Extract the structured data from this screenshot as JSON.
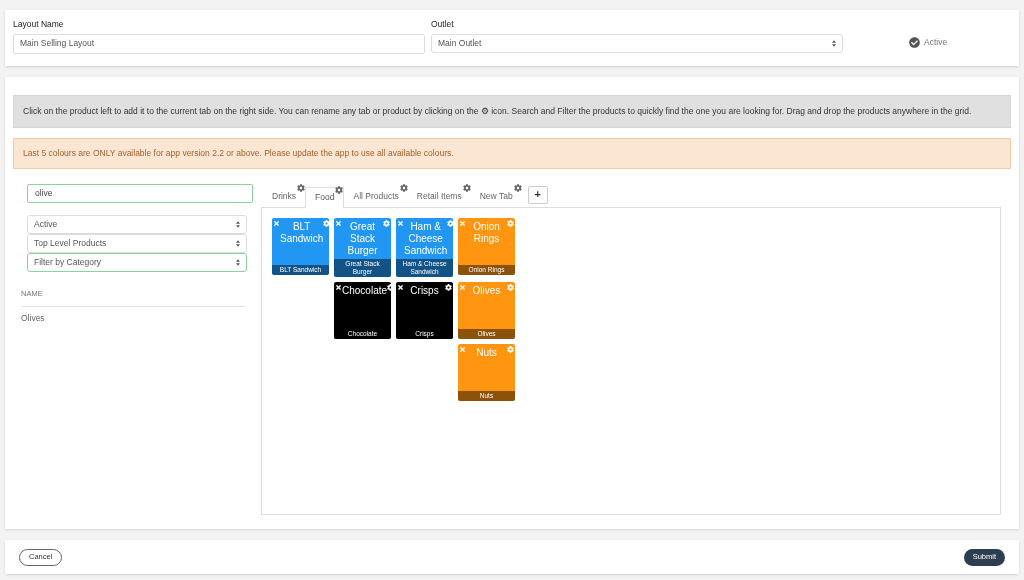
{
  "layout_form": {
    "name_label": "Layout Name",
    "name_value": "Main Selling Layout",
    "outlet_label": "Outlet",
    "outlet_value": "Main Outlet",
    "status": {
      "label": "Active",
      "checked": true
    }
  },
  "info_message": "Click on the product left to add it to the current tab on the right side. You can rename any tab or product by clicking on the ⚙ icon. Search and Filter the products to quickly find the one you are looking for. Drag and drop the products anywhere in the grid.",
  "warning_message": "Last 5 colours are ONLY available for app version 2.2 or above. Please update the app to use all available colours.",
  "filters": {
    "search_value": "olive",
    "selects": [
      {
        "value": "Active",
        "focused": false
      },
      {
        "value": "Top Level Products",
        "focused": false
      },
      {
        "value": "Filter by Category",
        "focused": true
      }
    ]
  },
  "product_table": {
    "column": "NAME",
    "rows": [
      "Olives"
    ]
  },
  "tabs": [
    {
      "label": "Drinks",
      "selected": false
    },
    {
      "label": "Food",
      "selected": true
    },
    {
      "label": "All Products",
      "selected": false
    },
    {
      "label": "Retail Items",
      "selected": false
    },
    {
      "label": "New Tab",
      "selected": false
    }
  ],
  "add_tab": "+",
  "grid": [
    [
      {
        "kind": "tile",
        "title": "BLT Sandwich",
        "caption": "BLT Sandwich",
        "color": "#2196f3"
      },
      {
        "kind": "tile",
        "title": "Great Stack Burger",
        "caption": "Great Stack Burger",
        "color": "#2196f3"
      },
      {
        "kind": "tile",
        "title": "Ham & Cheese Sandwich",
        "caption": "Ham & Cheese Sandwich",
        "color": "#2196f3"
      },
      {
        "kind": "tile",
        "title": "Onion Rings",
        "caption": "Onion Rings",
        "color": "#ff9511"
      }
    ],
    [
      {
        "kind": "empty"
      },
      {
        "kind": "tile",
        "title": "Chocolate",
        "caption": "Chocolate",
        "color": "#000000"
      },
      {
        "kind": "tile",
        "title": "Crisps",
        "caption": "Crisps",
        "color": "#000000"
      },
      {
        "kind": "tile",
        "title": "Olives",
        "caption": "Olives",
        "color": "#ff9511"
      }
    ],
    [
      {
        "kind": "empty"
      },
      {
        "kind": "empty"
      },
      {
        "kind": "empty"
      },
      {
        "kind": "tile",
        "title": "Nuts",
        "caption": "Nuts",
        "color": "#ff9511"
      }
    ]
  ],
  "buttons": {
    "cancel": "Cancel",
    "submit": "Submit"
  }
}
